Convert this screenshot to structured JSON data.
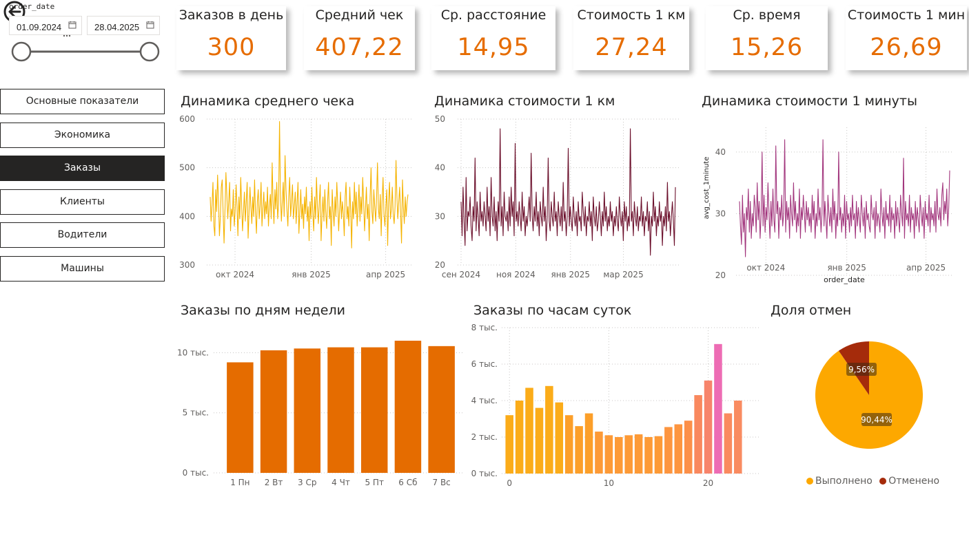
{
  "filter": {
    "title": "order_date",
    "date_from": "01.09.2024",
    "date_to": "28.04.2025"
  },
  "nav": [
    {
      "label": "Основные показатели",
      "active": false
    },
    {
      "label": "Экономика",
      "active": false
    },
    {
      "label": "Заказы",
      "active": true
    },
    {
      "label": "Клиенты",
      "active": false
    },
    {
      "label": "Водители",
      "active": false
    },
    {
      "label": "Машины",
      "active": false
    }
  ],
  "kpis": [
    {
      "title": "Заказов в день",
      "value": "300"
    },
    {
      "title": "Средний чек",
      "value": "407,22"
    },
    {
      "title": "Ср. расстояние",
      "value": "14,95"
    },
    {
      "title": "Стоимость 1 км",
      "value": "27,24"
    },
    {
      "title": "Ср. время",
      "value": "15,26"
    },
    {
      "title": "Стоимость 1 мин",
      "value": "26,69"
    }
  ],
  "colors": {
    "accent": "#e66c00",
    "check_line": "#f5b300",
    "km_line": "#6b0f2b",
    "minute_line": "#a2367d",
    "weekday_bar": "#e56c00",
    "dark": "#252423",
    "cancel": "#a52b0b",
    "done": "#fda800"
  },
  "chart_data": [
    {
      "id": "avg_check",
      "type": "line",
      "title": "Динамика среднего чека",
      "ylim": [
        300,
        600
      ],
      "yticks": [
        300,
        400,
        500,
        600
      ],
      "x_range": [
        "2024-09-01",
        "2025-04-28"
      ],
      "x_ticks": [
        {
          "date": "2024-10-01",
          "label": "окт 2024"
        },
        {
          "date": "2025-01-01",
          "label": "янв 2025"
        },
        {
          "date": "2025-04-01",
          "label": "апр 2025"
        }
      ],
      "x_step_days": 1,
      "y": [
        440,
        390,
        425,
        470,
        380,
        360,
        455,
        410,
        485,
        430,
        360,
        400,
        460,
        475,
        405,
        345,
        415,
        490,
        445,
        395,
        430,
        470,
        370,
        415,
        400,
        455,
        380,
        410,
        465,
        420,
        360,
        440,
        395,
        480,
        425,
        370,
        410,
        450,
        390,
        430,
        470,
        355,
        405,
        460,
        420,
        385,
        440,
        400,
        475,
        410,
        365,
        430,
        455,
        395,
        420,
        470,
        380,
        415,
        450,
        395,
        430,
        405,
        460,
        380,
        420,
        445,
        395,
        510,
        430,
        385,
        455,
        415,
        470,
        395,
        425,
        595,
        445,
        390,
        430,
        470,
        400,
        525,
        455,
        415,
        380,
        440,
        480,
        400,
        430,
        465,
        395,
        420,
        450,
        385,
        430,
        470,
        365,
        410,
        455,
        395,
        425,
        375,
        440,
        405,
        460,
        390,
        420,
        350,
        430,
        395,
        460,
        405,
        370,
        440,
        395,
        480,
        420,
        385,
        430,
        465,
        350,
        405,
        440,
        390,
        455,
        410,
        375,
        430,
        470,
        395,
        420,
        340,
        455,
        410,
        380,
        440,
        400,
        470,
        425,
        370,
        415,
        450,
        395,
        430,
        405,
        360,
        440,
        470,
        395,
        420,
        380,
        460,
        410,
        335,
        430,
        395,
        470,
        405,
        450,
        380,
        420,
        465,
        390,
        440,
        405,
        480,
        430,
        370,
        415,
        460,
        395,
        425,
        350,
        440,
        500,
        410,
        385,
        455,
        420,
        390,
        440,
        510,
        415,
        395,
        445,
        360,
        430,
        480,
        405,
        380,
        420,
        455,
        340,
        430,
        470,
        395,
        415,
        460,
        405,
        385,
        420,
        515,
        440,
        395,
        430,
        460,
        405,
        345,
        475,
        420,
        385,
        440,
        400,
        430,
        445
      ]
    },
    {
      "id": "cost_km",
      "type": "line",
      "title": "Динамика стоимости 1 км",
      "ylim": [
        20,
        50
      ],
      "yticks": [
        20,
        30,
        40,
        50
      ],
      "x_range": [
        "2024-09-01",
        "2025-04-28"
      ],
      "x_ticks": [
        {
          "date": "2024-09-01",
          "label": "сен 2024"
        },
        {
          "date": "2024-11-01",
          "label": "ноя 2024"
        },
        {
          "date": "2025-01-01",
          "label": "янв 2025"
        },
        {
          "date": "2025-03-01",
          "label": "мар 2025"
        }
      ],
      "x_step_days": 1,
      "y": [
        33,
        26,
        36,
        29,
        24,
        38,
        27,
        31,
        30,
        34,
        28,
        25,
        32,
        29,
        42,
        27,
        33,
        30,
        26,
        35,
        29,
        31,
        28,
        33,
        30,
        27,
        36,
        29,
        32,
        26,
        38,
        30,
        28,
        34,
        27,
        31,
        25,
        33,
        29,
        48,
        28,
        32,
        26,
        35,
        30,
        29,
        31,
        27,
        34,
        28,
        36,
        30,
        33,
        26,
        45,
        29,
        31,
        28,
        33,
        30,
        27,
        35,
        29,
        32,
        26,
        30,
        28,
        31,
        34,
        29,
        43,
        30,
        27,
        32,
        29,
        35,
        28,
        31,
        26,
        33,
        30,
        28,
        36,
        29,
        32,
        25,
        30,
        42,
        29,
        27,
        33,
        30,
        28,
        35,
        29,
        31,
        26,
        33,
        30,
        28,
        32,
        27,
        37,
        29,
        31,
        26,
        30,
        44,
        28,
        32,
        29,
        27,
        34,
        30,
        28,
        31,
        26,
        33,
        29,
        30,
        27,
        35,
        31,
        28,
        32,
        26,
        30,
        29,
        33,
        28,
        31,
        25,
        34,
        30,
        28,
        32,
        27,
        29,
        33,
        30,
        26,
        31,
        28,
        35,
        29,
        32,
        27,
        30,
        28,
        33,
        29,
        31,
        26,
        30,
        28,
        32,
        29,
        27,
        34,
        30,
        28,
        31,
        25,
        33,
        29,
        32,
        27,
        30,
        28,
        48,
        29,
        31,
        26,
        33,
        30,
        28,
        32,
        27,
        30,
        29,
        34,
        28,
        31,
        26,
        30,
        29,
        33,
        27,
        31,
        22,
        30,
        28,
        35,
        29,
        32,
        26,
        30,
        28,
        33,
        29,
        31,
        24,
        30,
        28,
        32,
        27,
        37,
        29,
        31,
        26,
        30,
        33,
        29,
        24,
        36
      ]
    },
    {
      "id": "cost_min",
      "type": "line",
      "title": "Динамика стоимости 1 минуты",
      "ylabel": "avg_cost_1minute",
      "xlabel": "order_date",
      "ylim": [
        20,
        44
      ],
      "yticks": [
        20,
        30,
        40
      ],
      "x_range": [
        "2024-09-01",
        "2025-04-28"
      ],
      "x_ticks": [
        {
          "date": "2024-10-01",
          "label": "окт 2024"
        },
        {
          "date": "2025-01-01",
          "label": "янв 2025"
        },
        {
          "date": "2025-04-01",
          "label": "апр 2025"
        }
      ],
      "x_step_days": 1,
      "y": [
        32,
        28,
        25,
        33,
        27,
        30,
        23,
        31,
        29,
        34,
        27,
        32,
        26,
        30,
        28,
        33,
        31,
        27,
        35,
        29,
        32,
        26,
        30,
        40,
        28,
        33,
        27,
        31,
        29,
        35,
        30,
        26,
        32,
        28,
        34,
        29,
        27,
        41,
        30,
        32,
        26,
        31,
        29,
        33,
        28,
        30,
        42,
        27,
        32,
        29,
        31,
        26,
        33,
        30,
        28,
        35,
        29,
        32,
        27,
        30,
        28,
        34,
        26,
        31,
        29,
        33,
        30,
        27,
        32,
        29,
        31,
        28,
        30,
        27,
        33,
        29,
        32,
        26,
        30,
        28,
        34,
        29,
        31,
        27,
        30,
        42,
        28,
        32,
        29,
        26,
        33,
        30,
        28,
        31,
        27,
        34,
        29,
        32,
        26,
        30,
        28,
        40,
        29,
        31,
        27,
        30,
        28,
        33,
        26,
        32,
        29,
        30,
        27,
        31,
        28,
        33,
        29,
        30,
        26,
        32,
        28,
        31,
        29,
        27,
        33,
        30,
        28,
        31,
        26,
        32,
        29,
        30,
        28,
        27,
        33,
        30,
        29,
        31,
        26,
        32,
        28,
        30,
        29,
        27,
        34,
        30,
        28,
        31,
        26,
        32,
        29,
        30,
        28,
        33,
        27,
        31,
        29,
        30,
        26,
        32,
        28,
        31,
        29,
        27,
        33,
        30,
        28,
        39,
        26,
        32,
        29,
        30,
        28,
        33,
        27,
        31,
        29,
        30,
        26,
        32,
        28,
        31,
        29,
        27,
        33,
        30,
        28,
        31,
        26,
        32,
        29,
        30,
        28,
        33,
        27,
        31,
        29,
        30,
        28,
        32,
        27,
        34,
        30,
        29,
        31,
        28,
        33,
        35,
        29,
        32,
        30,
        34,
        28,
        31,
        37
      ]
    },
    {
      "id": "weekday",
      "type": "bar",
      "title": "Заказы по дням недели",
      "categories": [
        "1 Пн",
        "2 Вт",
        "3 Ср",
        "4 Чт",
        "5 Пт",
        "6 Сб",
        "7 Вс"
      ],
      "values": [
        9200,
        10200,
        10350,
        10450,
        10450,
        11000,
        10550
      ],
      "ylim": [
        0,
        11000
      ],
      "yticks": [
        {
          "v": 0,
          "label": "0 тыс."
        },
        {
          "v": 5000,
          "label": "5 тыс."
        },
        {
          "v": 10000,
          "label": "10 тыс."
        }
      ]
    },
    {
      "id": "hour",
      "type": "bar",
      "title": "Заказы по часам суток",
      "categories": [
        0,
        1,
        2,
        3,
        4,
        5,
        6,
        7,
        8,
        9,
        10,
        11,
        12,
        13,
        14,
        15,
        16,
        17,
        18,
        19,
        20,
        21,
        22,
        23
      ],
      "values": [
        3200,
        4000,
        4700,
        3600,
        4800,
        3900,
        3200,
        2600,
        3300,
        2300,
        2100,
        2000,
        2100,
        2150,
        2000,
        2050,
        2550,
        2700,
        2900,
        4300,
        5100,
        7100,
        3300,
        4000
      ],
      "bar_colors": [
        "#fbac19",
        "#fbac19",
        "#fbac19",
        "#fbac19",
        "#fbac19",
        "#fbac19",
        "#fc9f29",
        "#fc9f29",
        "#fc9f29",
        "#fd9a36",
        "#fd9a36",
        "#fd9a36",
        "#fd9a36",
        "#fd9a36",
        "#fd9a36",
        "#fd9a36",
        "#fd953f",
        "#fd953f",
        "#fc9049",
        "#f9885e",
        "#f7846b",
        "#ed6cb4",
        "#fa8a5f",
        "#f98b60"
      ],
      "ylim": [
        0,
        8000
      ],
      "yticks": [
        {
          "v": 0,
          "label": "0 тыс."
        },
        {
          "v": 2000,
          "label": "2 тыс."
        },
        {
          "v": 4000,
          "label": "4 тыс."
        },
        {
          "v": 6000,
          "label": "6 тыс."
        },
        {
          "v": 8000,
          "label": "8 тыс."
        }
      ],
      "xticks": [
        {
          "v": 0,
          "label": "0"
        },
        {
          "v": 10,
          "label": "10"
        },
        {
          "v": 20,
          "label": "20"
        }
      ]
    },
    {
      "id": "cancel_share",
      "type": "pie",
      "title": "Доля отмен",
      "slices": [
        {
          "name": "Выполнено",
          "value": 90.44,
          "label": "90,44%",
          "color": "#fda800"
        },
        {
          "name": "Отменено",
          "value": 9.56,
          "label": "9,56%",
          "color": "#a52b0b"
        }
      ]
    }
  ]
}
